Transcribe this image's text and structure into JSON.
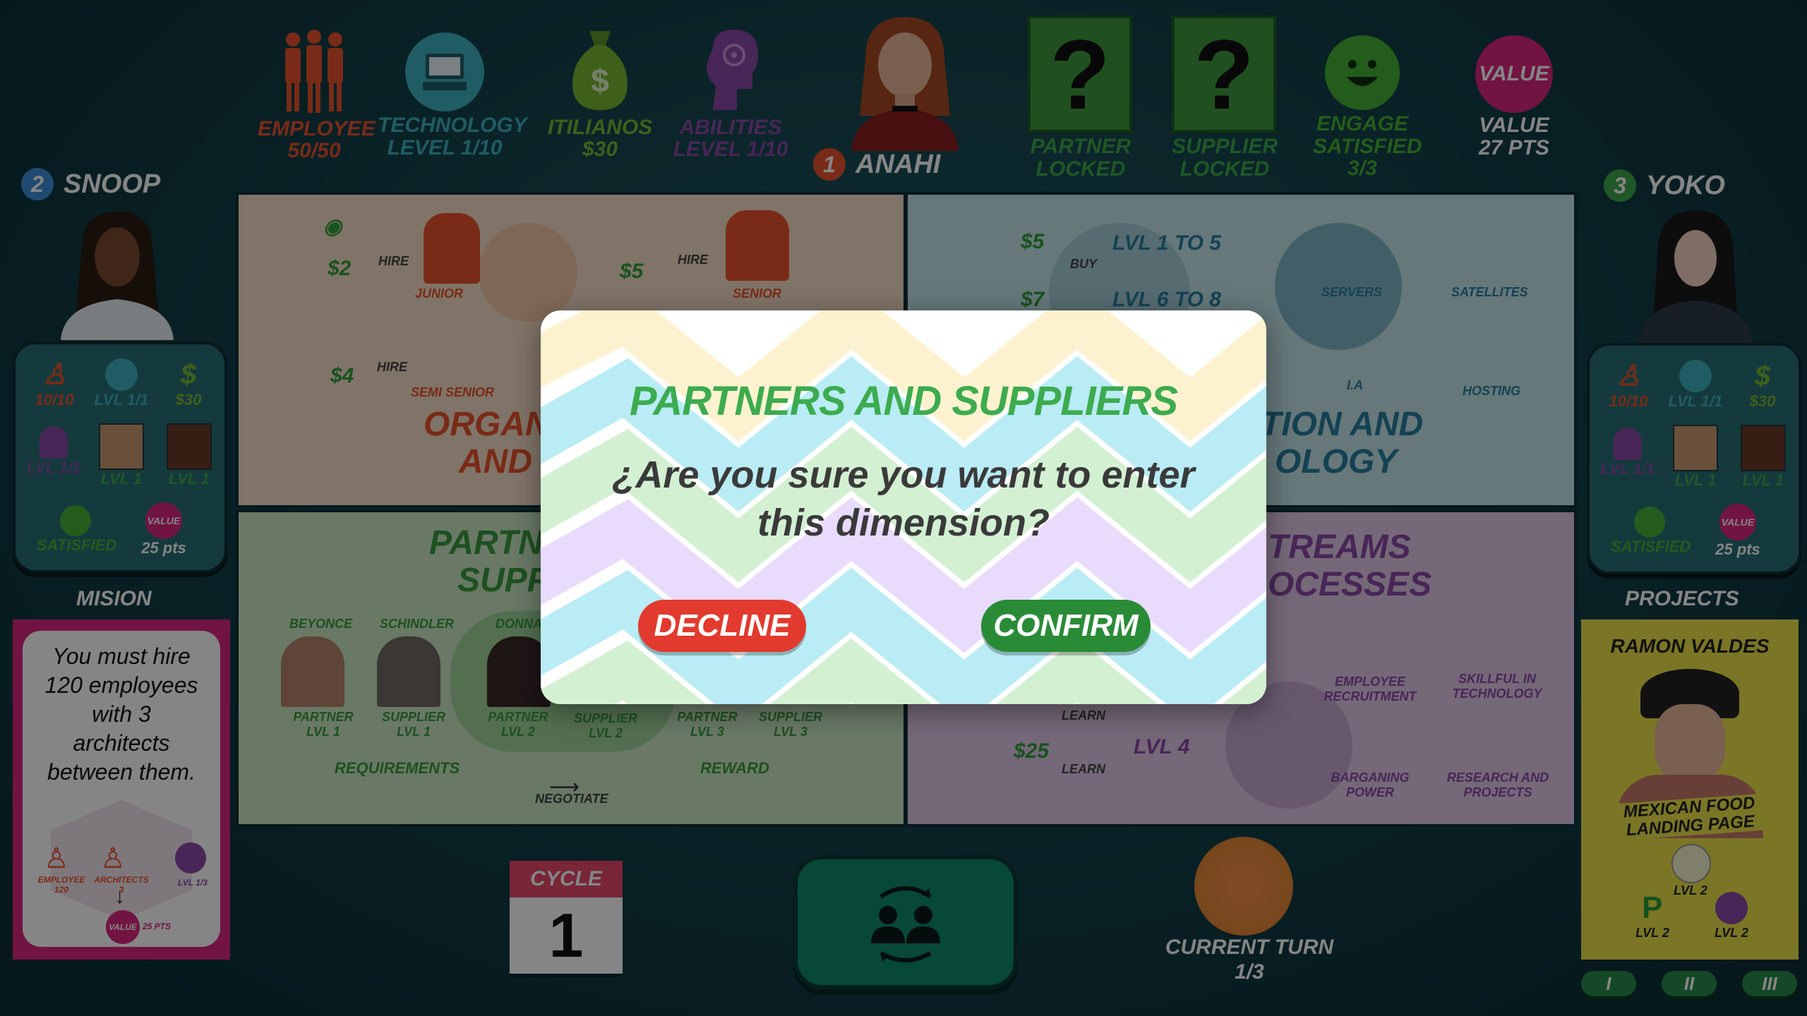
{
  "top_stats": {
    "employee": {
      "label": "EMPLOYEE",
      "value": "50/50"
    },
    "technology": {
      "label": "TECHNOLOGY",
      "value": "LEVEL 1/10"
    },
    "itilianos": {
      "label": "ITILIANOS",
      "value": "$30"
    },
    "abilities": {
      "label": "ABILITIES",
      "value": "LEVEL 1/10"
    },
    "partner": {
      "line1": "PARTNER",
      "line2": "LOCKED",
      "symbol": "?"
    },
    "supplier": {
      "line1": "SUPPLIER",
      "line2": "LOCKED",
      "symbol": "?"
    },
    "engage": {
      "line1": "ENGAGE",
      "line2": "SATISFIED",
      "line3": "3/3"
    },
    "value": {
      "badge": "VALUE",
      "line1": "VALUE",
      "line2": "27 PTS"
    }
  },
  "players": {
    "center": {
      "number": "1",
      "name": "ANAHI"
    },
    "left": {
      "number": "2",
      "name": "SNOOP"
    },
    "right": {
      "number": "3",
      "name": "YOKO"
    }
  },
  "left_panel": {
    "employees": "10/10",
    "tech": "LVL 1/1",
    "money": "$30",
    "ability": "LVL 1/1",
    "partner": "LVL 1",
    "supplier": "LVL 1",
    "satisfied": "SATISFIED",
    "value_badge": "VALUE",
    "points": "25 pts"
  },
  "right_panel": {
    "employees": "10/10",
    "tech": "LVL 1/1",
    "money": "$30",
    "ability": "LVL 1/1",
    "partner": "LVL 1",
    "supplier": "LVL 1",
    "satisfied": "SATISFIED",
    "value_badge": "VALUE",
    "points": "25 pts"
  },
  "board": {
    "org": {
      "title1": "ORGANI",
      "title2": "AND P",
      "row1_cost": "$2",
      "row1_action": "HIRE",
      "row1_role": "JUNIOR",
      "row2_cost": "$5",
      "row2_action": "HIRE",
      "row2_role": "SENIOR",
      "row3_cost": "$4",
      "row3_action": "HIRE",
      "row3_role": "SEMI SENIOR"
    },
    "tech": {
      "title1": "TION AND",
      "title2": "OLOGY",
      "row1_cost": "$5",
      "row1_action": "BUY",
      "row1_range": "LVL 1 TO 5",
      "row2_cost": "$7",
      "row2_range": "LVL 6 TO 8",
      "servers": "SERVERS",
      "satellites": "SATELLITES",
      "ia": "I.A",
      "hosting": "HOSTING"
    },
    "partners": {
      "title1": "PARTN",
      "title2": "SUPP",
      "p1_name": "BEYONCE",
      "p2_name": "SCHINDLER",
      "p3_name": "DONNA",
      "p1_label": "PARTNER",
      "p1_lvl": "LVL 1",
      "p2_label": "SUPPLIER",
      "p2_lvl": "LVL 1",
      "p3_label": "PARTNER",
      "p3_lvl": "LVL 2",
      "p4_label": "SUPPLIER",
      "p4_lvl": "LVL 2",
      "p5_label": "PARTNER",
      "p5_lvl": "LVL 3",
      "p6_label": "SUPPLIER",
      "p6_lvl": "LVL 3",
      "requirements": "REQUIREMENTS",
      "reward": "REWARD",
      "negotiate": "NEGOTIATE"
    },
    "streams": {
      "title1": "TREAMS",
      "title2": "OCESSES",
      "recruit1": "EMPLOYEE",
      "recruit2": "RECRUITMENT",
      "skill1": "SKILLFUL IN",
      "skill2": "TECHNOLOGY",
      "barg1": "BARGANING",
      "barg2": "POWER",
      "research1": "RESEARCH AND",
      "research2": "PROJECTS",
      "learn1": "LEARN",
      "learn_cost": "$25",
      "learn2": "LEARN",
      "learn_lvl": "LVL 4"
    }
  },
  "modal": {
    "title": "PARTNERS AND SUPPLIERS",
    "question_line1": "¿Are you sure you want to enter",
    "question_line2": "this dimension?",
    "decline": "DECLINE",
    "confirm": "CONFIRM"
  },
  "mission": {
    "heading": "MISION",
    "line1": "You must hire",
    "line2": "120 employees",
    "line3": "with 3",
    "line4": "architects",
    "line5": "between them.",
    "emp_label": "EMPLOYEE",
    "emp_value": "120",
    "arch_label": "ARCHITECTS",
    "arch_value": "3",
    "lvl_label": "LVL 1/3",
    "value_badge": "VALUE",
    "reward_pts": "25 PTS"
  },
  "projects": {
    "heading": "PROJECTS",
    "name": "RAMON VALDES",
    "project1": "MEXICAN FOOD",
    "project2": "LANDING PAGE",
    "req1": "LVL 2",
    "req2": "LVL 2",
    "req3": "LVL 2",
    "p_symbol": "P",
    "tab1": "I",
    "tab2": "II",
    "tab3": "III"
  },
  "bottom": {
    "cycle_label": "CYCLE",
    "cycle_value": "1",
    "turn_label": "CURRENT TURN",
    "turn_value": "1/3"
  },
  "colors": {
    "employee": "#e8542c",
    "technology": "#3fb1bf",
    "itilianos": "#7ab834",
    "abilities": "#8a4aa8",
    "green_btn": "#2a8b37",
    "red_btn": "#e23a2e",
    "title_green": "#3dab4f"
  }
}
